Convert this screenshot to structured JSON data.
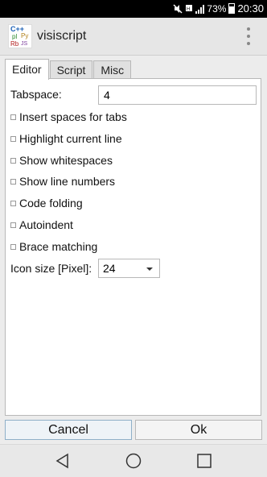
{
  "status_bar": {
    "battery_percent": "73%",
    "time": "20:30",
    "icons": [
      "mute-icon",
      "data-icon",
      "signal-icon",
      "battery-icon"
    ]
  },
  "app_bar": {
    "title": "visiscript",
    "logo_text": [
      "C++",
      "pl",
      "Py",
      "Rb",
      "JS"
    ]
  },
  "tabs": [
    {
      "label": "Editor",
      "active": true
    },
    {
      "label": "Script",
      "active": false
    },
    {
      "label": "Misc",
      "active": false
    }
  ],
  "editor": {
    "tabspace_label": "Tabspace:",
    "tabspace_value": "4",
    "options": [
      {
        "label": "Insert spaces for tabs",
        "checked": false
      },
      {
        "label": "Highlight current line",
        "checked": false
      },
      {
        "label": "Show whitespaces",
        "checked": false
      },
      {
        "label": "Show line numbers",
        "checked": false
      },
      {
        "label": "Code folding",
        "checked": false
      },
      {
        "label": "Autoindent",
        "checked": false
      },
      {
        "label": "Brace matching",
        "checked": false
      }
    ],
    "icon_size_label": "Icon size [Pixel]:",
    "icon_size_value": "24"
  },
  "buttons": {
    "cancel": "Cancel",
    "ok": "Ok"
  },
  "nav": [
    "back-icon",
    "home-icon",
    "recents-icon"
  ]
}
